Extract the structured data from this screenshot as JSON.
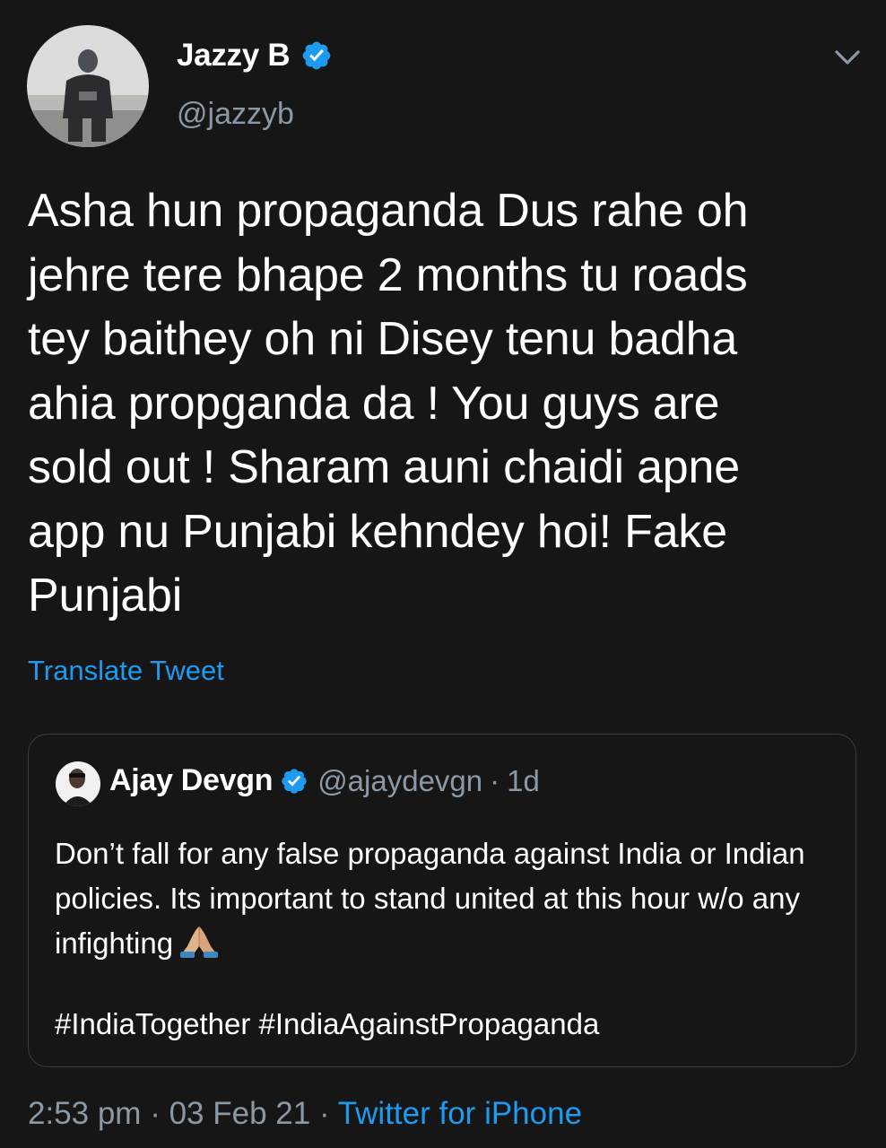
{
  "tweet": {
    "author": {
      "name": "Jazzy B",
      "handle": "@jazzyb",
      "verified": true
    },
    "text": "Asha hun propaganda Dus rahe oh\njehre tere bhape 2 months tu roads\ntey baithey oh ni Disey tenu badha\nahia propganda da ! You guys are\nsold out ! Sharam auni chaidi apne\napp nu Punjabi kehndey hoi! Fake\nPunjabi",
    "translate_label": "Translate Tweet",
    "quoted": {
      "name": "Ajay Devgn",
      "handle": "@ajaydevgn",
      "separator": "·",
      "time": "1d",
      "text": "Don’t fall for any false propaganda against India or Indian policies. Its important to stand united at this hour w/o any infighting",
      "emoji": "folded-hands-emoji",
      "hashtags": "#IndiaTogether #IndiaAgainstPropaganda"
    },
    "footer": {
      "time": "2:53 pm",
      "sep1": "·",
      "date": "03 Feb 21",
      "sep2": "·",
      "source": "Twitter for iPhone"
    }
  },
  "colors": {
    "background": "#161616",
    "text": "#ffffff",
    "secondary": "#8b98a5",
    "accent": "#1d9bf0",
    "border": "#3a3d41"
  },
  "icons": {
    "verified": "verified-badge-icon",
    "menu": "chevron-down-icon"
  }
}
